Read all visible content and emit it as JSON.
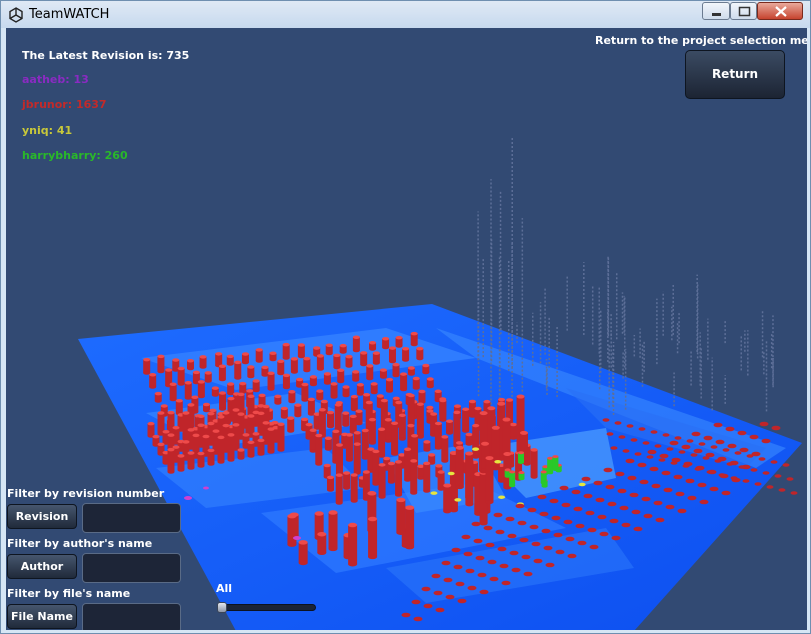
{
  "window": {
    "title": "TeamWATCH",
    "icon": "unity-icon",
    "controls": [
      "minimize-icon",
      "maximize-icon",
      "close-icon"
    ]
  },
  "hud": {
    "latest_revision": "The Latest Revision is: 735",
    "return_hint": "Return to the project selection menu",
    "return_label": "Return",
    "authors": [
      {
        "text": "aatheb: 13",
        "color": "#8a2bc2"
      },
      {
        "text": "jbrunor: 1637",
        "color": "#c22a2a"
      },
      {
        "text": "yniq: 41",
        "color": "#c8c83a"
      },
      {
        "text": "harrybharry: 260",
        "color": "#29b829"
      }
    ]
  },
  "filters": {
    "revision": {
      "label": "Filter by revision number",
      "button": "Revision",
      "value": ""
    },
    "author": {
      "label": "Filter by author's name",
      "button": "Author",
      "value": ""
    },
    "file": {
      "label": "Filter by file's name",
      "button": "File Name",
      "value": ""
    }
  },
  "slider": {
    "label": "All",
    "value": 0
  },
  "colors": {
    "background": "#324a73",
    "floor": "#1660ff",
    "building": "#c0252a",
    "highlight_green": "#29c829",
    "highlight_yellow": "#e6e640",
    "highlight_magenta": "#d040d0"
  }
}
